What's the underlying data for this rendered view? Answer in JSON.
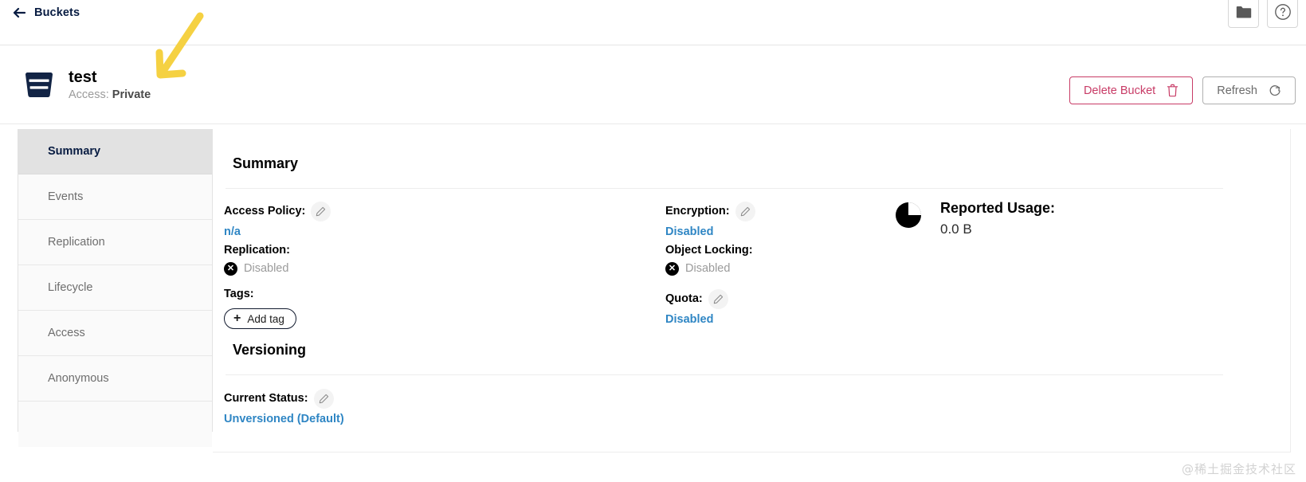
{
  "topbar": {
    "back_label": "Buckets",
    "back_icon": "arrow-left-icon",
    "folder_icon": "folder-icon",
    "help_icon": "help-circle-icon"
  },
  "bucket": {
    "icon": "bucket-icon",
    "name": "test",
    "access_prefix": "Access:",
    "access_value": "Private"
  },
  "actions": {
    "delete_label": "Delete Bucket",
    "delete_icon": "trash-icon",
    "delete_color": "#c83b66",
    "refresh_label": "Refresh",
    "refresh_icon": "refresh-icon"
  },
  "sidebar": {
    "items": [
      {
        "label": "Summary",
        "active": true
      },
      {
        "label": "Events",
        "active": false
      },
      {
        "label": "Replication",
        "active": false
      },
      {
        "label": "Lifecycle",
        "active": false
      },
      {
        "label": "Access",
        "active": false
      },
      {
        "label": "Anonymous",
        "active": false
      }
    ]
  },
  "summary": {
    "title": "Summary",
    "access_policy": {
      "label": "Access Policy:",
      "value": "n/a",
      "edit_icon": "pencil-icon"
    },
    "replication": {
      "label": "Replication:",
      "value": "Disabled",
      "status_icon": "x-circle-icon"
    },
    "tags": {
      "label": "Tags:",
      "add_label": "Add tag",
      "add_icon": "plus-icon"
    },
    "encryption": {
      "label": "Encryption:",
      "value": "Disabled",
      "edit_icon": "pencil-icon"
    },
    "object_locking": {
      "label": "Object Locking:",
      "value": "Disabled",
      "status_icon": "x-circle-icon"
    },
    "quota": {
      "label": "Quota:",
      "value": "Disabled",
      "edit_icon": "pencil-icon"
    },
    "reported_usage": {
      "label": "Reported Usage:",
      "value": "0.0 B",
      "icon": "pie-chart-icon"
    }
  },
  "versioning": {
    "title": "Versioning",
    "current_status": {
      "label": "Current Status:",
      "value": "Unversioned (Default)",
      "edit_icon": "pencil-icon"
    }
  },
  "annotation": {
    "arrow_color": "#f5d142",
    "arrow_icon": "annotation-arrow-icon"
  },
  "watermark": "@稀土掘金技术社区"
}
